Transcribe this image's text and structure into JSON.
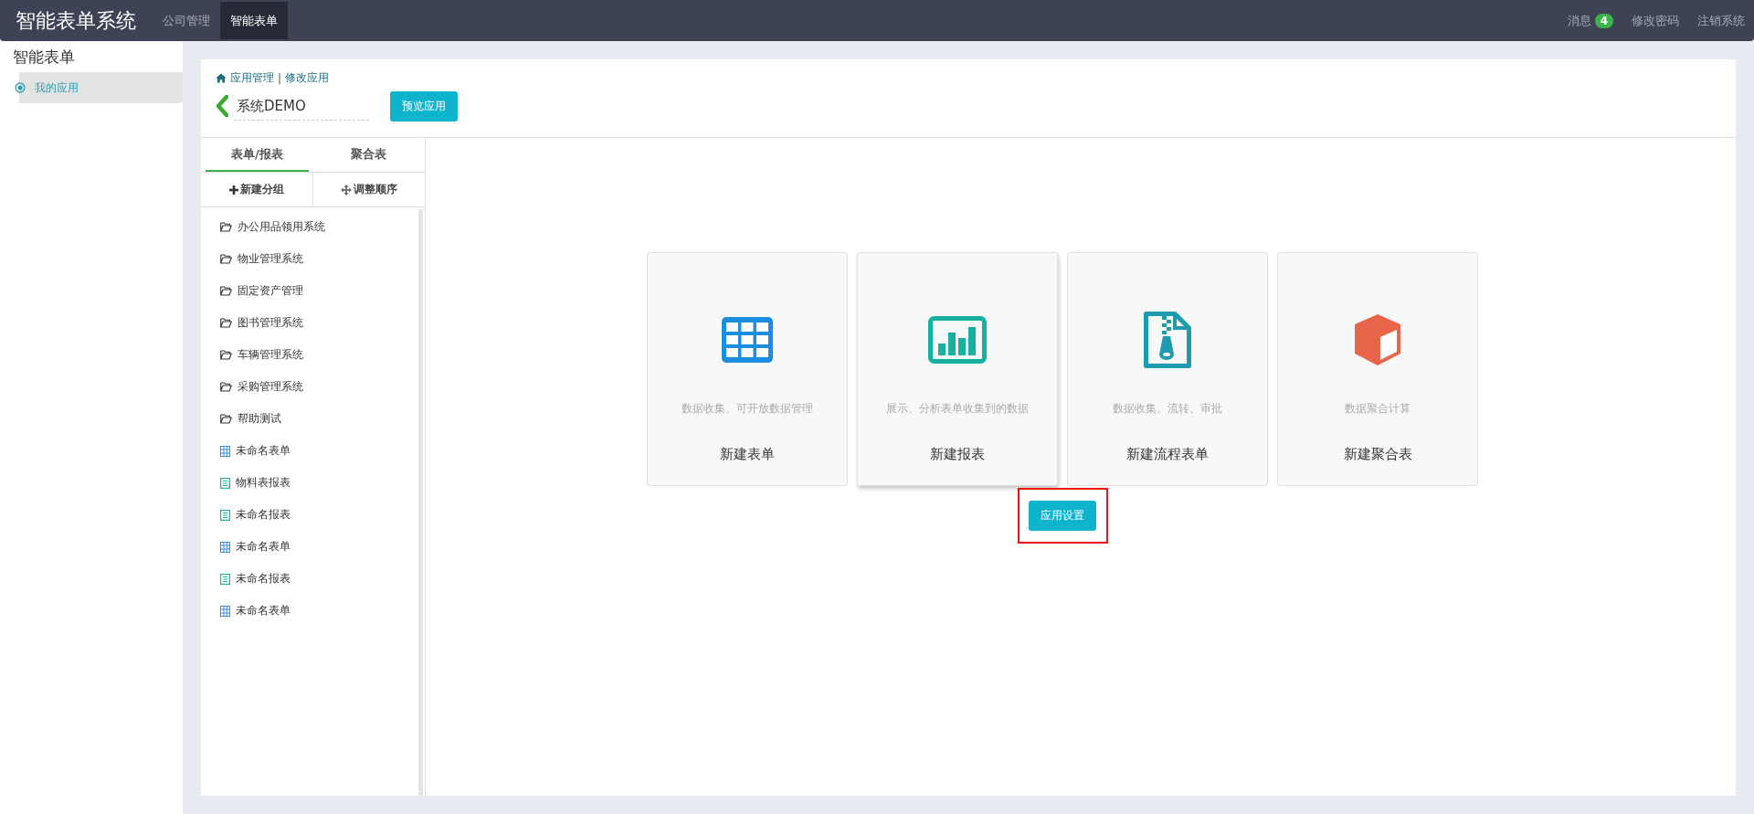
{
  "header": {
    "title": "智能表单系统",
    "nav": [
      {
        "label": "公司管理",
        "selected": false
      },
      {
        "label": "智能表单",
        "selected": true
      }
    ],
    "links": [
      {
        "label": "消息",
        "badge": "4"
      },
      {
        "label": "修改密码"
      },
      {
        "label": "注销系统"
      }
    ]
  },
  "sidebar": {
    "title": "智能表单",
    "items": [
      {
        "label": "我的应用",
        "selected": true
      }
    ]
  },
  "breadcrumb": {
    "items": [
      "应用管理",
      "修改应用"
    ],
    "separator": "|"
  },
  "app": {
    "name": "系统DEMO",
    "preview_button": "预览应用"
  },
  "tabs": [
    {
      "label": "表单/报表",
      "selected": true
    },
    {
      "label": "聚合表",
      "selected": false
    }
  ],
  "tools": [
    {
      "kind": "add",
      "label": "新建分组"
    },
    {
      "kind": "move",
      "label": "调整顺序"
    }
  ],
  "items": [
    {
      "kind": "folder",
      "label": "办公用品领用系统"
    },
    {
      "kind": "folder",
      "label": "物业管理系统"
    },
    {
      "kind": "folder",
      "label": "固定资产管理"
    },
    {
      "kind": "folder",
      "label": "图书管理系统"
    },
    {
      "kind": "folder",
      "label": "车辆管理系统"
    },
    {
      "kind": "folder",
      "label": "采购管理系统"
    },
    {
      "kind": "folder",
      "label": "帮助测试"
    },
    {
      "kind": "form",
      "label": "未命名表单"
    },
    {
      "kind": "report",
      "label": "物料表报表"
    },
    {
      "kind": "report",
      "label": "未命名报表"
    },
    {
      "kind": "form",
      "label": "未命名表单"
    },
    {
      "kind": "report",
      "label": "未命名报表"
    },
    {
      "kind": "form",
      "label": "未命名表单"
    }
  ],
  "cards": [
    {
      "kind": "form",
      "description": "数据收集、可开放数据管理",
      "title": "新建表单",
      "raised": false
    },
    {
      "kind": "report",
      "description": "展示、分析表单收集到的数据",
      "title": "新建报表",
      "raised": true
    },
    {
      "kind": "flow",
      "description": "数据收集、流转、审批",
      "title": "新建流程表单",
      "raised": false
    },
    {
      "kind": "aggregate",
      "description": "数据聚合计算",
      "title": "新建聚合表",
      "raised": false
    }
  ],
  "settings_button": {
    "label": "应用设置",
    "highlighted": true
  }
}
